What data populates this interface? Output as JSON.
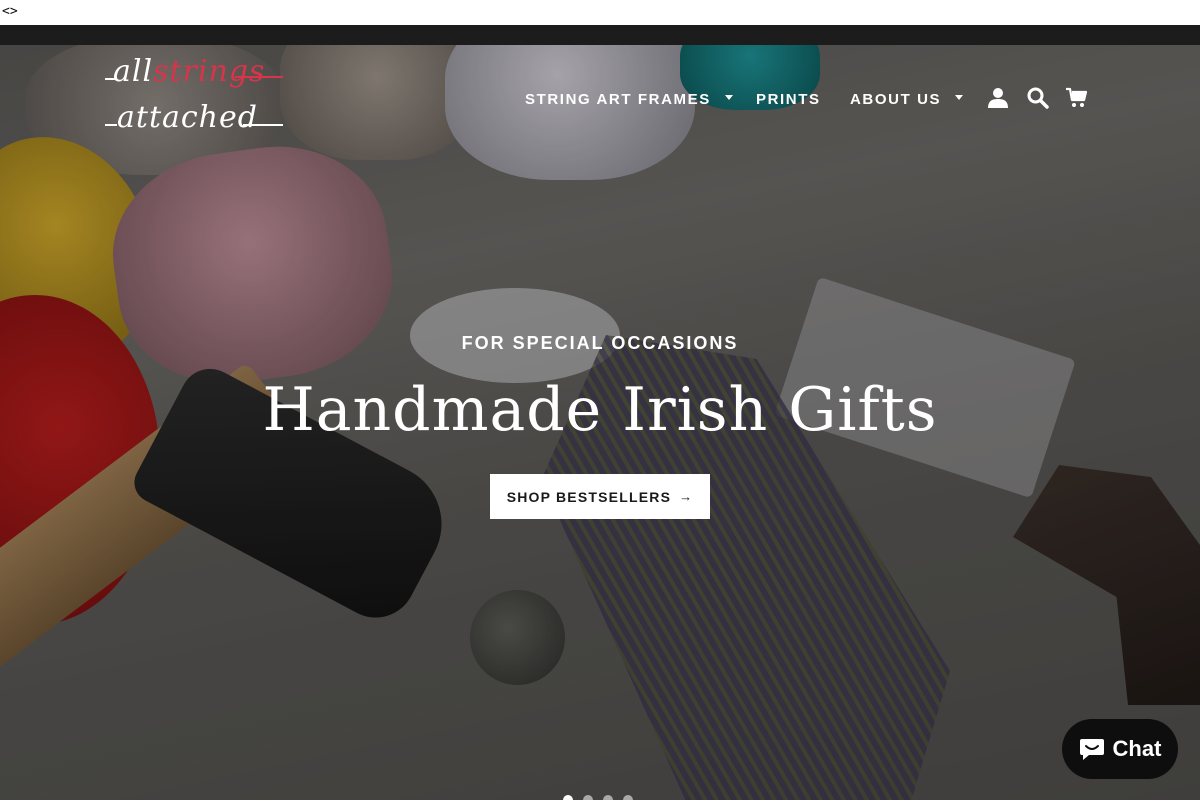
{
  "topline": {
    "code_text": "<>"
  },
  "brand": {
    "logo_line1_a": "all",
    "logo_line1_b": "strings",
    "logo_line2": "attached",
    "accent_color": "#d8344a"
  },
  "nav": {
    "items": [
      {
        "label": "STRING ART FRAMES",
        "has_dropdown": true
      },
      {
        "label": "PRINTS",
        "has_dropdown": false
      },
      {
        "label": "ABOUT US",
        "has_dropdown": true
      }
    ],
    "icons": [
      "account-icon",
      "search-icon",
      "cart-icon"
    ]
  },
  "hero": {
    "eyebrow": "FOR SPECIAL OCCASIONS",
    "headline": "Handmade Irish Gifts",
    "cta_label": "SHOP BESTSELLERS",
    "cta_arrow": "→",
    "slide_count": 4,
    "active_slide": 1
  },
  "chat": {
    "label": "Chat"
  }
}
